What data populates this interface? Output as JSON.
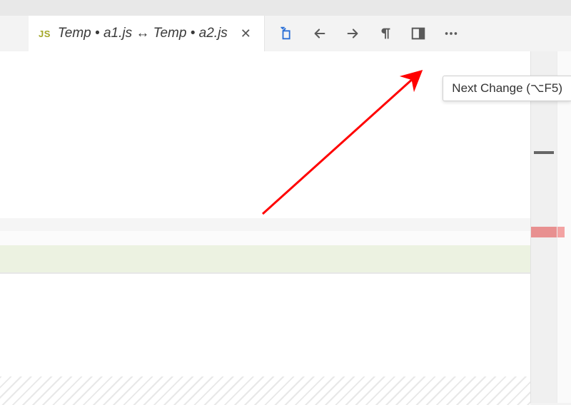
{
  "tab": {
    "file_badge": "JS",
    "title": "Temp • a1.js ↔ Temp • a2.js",
    "close_glyph": "✕"
  },
  "toolbar": {
    "open_file": {
      "name": "open-changes-icon"
    },
    "prev_change": {
      "name": "previous-change-icon"
    },
    "next_change": {
      "name": "next-change-icon"
    },
    "whitespace": {
      "name": "show-whitespace-icon"
    },
    "layout": {
      "name": "toggle-layout-icon"
    },
    "more": {
      "name": "more-actions-icon"
    }
  },
  "tooltip": {
    "text": "Next Change (⌥F5)"
  },
  "annotation": {
    "color": "#ff0000"
  }
}
